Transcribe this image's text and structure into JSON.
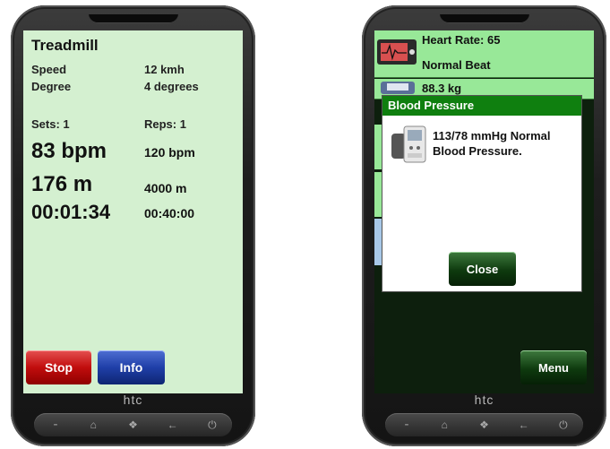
{
  "brand": "htc",
  "left": {
    "title": "Treadmill",
    "speed_label": "Speed",
    "speed_value": "12 kmh",
    "degree_label": "Degree",
    "degree_value": "4 degrees",
    "sets": "Sets: 1",
    "reps": "Reps: 1",
    "heart_rate": "83 bpm",
    "heart_rate_target": "120 bpm",
    "distance": "176 m",
    "distance_target": "4000 m",
    "time": "00:01:34",
    "time_target": "00:40:00",
    "stop_label": "Stop",
    "info_label": "Info"
  },
  "right": {
    "heart_rate_line": "Heart Rate: 65",
    "beat_status": "Normal Beat",
    "weight": "88.3 kg",
    "dialog_title": "Blood Pressure",
    "dialog_message": "113/78 mmHg Normal Blood Pressure.",
    "close_label": "Close",
    "menu_label": "Menu"
  },
  "colors": {
    "screen_bg": "#d4f0d0",
    "row_bg": "#98e898",
    "dialog_header": "#0f7f0f",
    "stop": "#c10d0d",
    "info": "#1f3fa8"
  }
}
